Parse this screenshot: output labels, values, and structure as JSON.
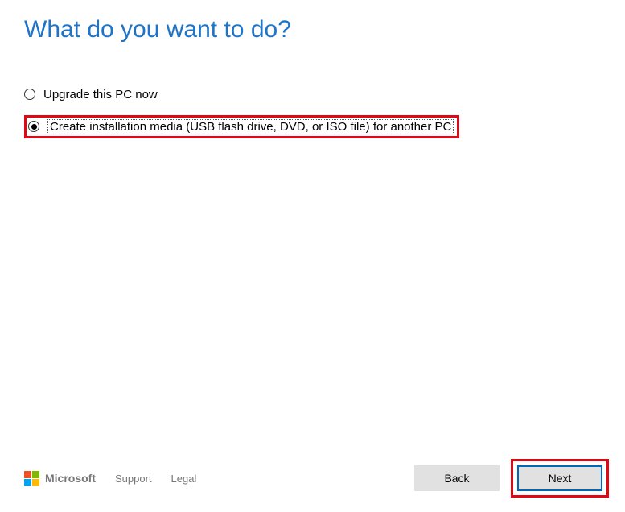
{
  "heading": "What do you want to do?",
  "options": [
    {
      "label": "Upgrade this PC now",
      "checked": false,
      "highlighted": false
    },
    {
      "label": "Create installation media (USB flash drive, DVD, or ISO file) for another PC",
      "checked": true,
      "highlighted": true
    }
  ],
  "footer": {
    "brand": "Microsoft",
    "links": [
      "Support",
      "Legal"
    ]
  },
  "buttons": {
    "back": "Back",
    "next": "Next"
  }
}
